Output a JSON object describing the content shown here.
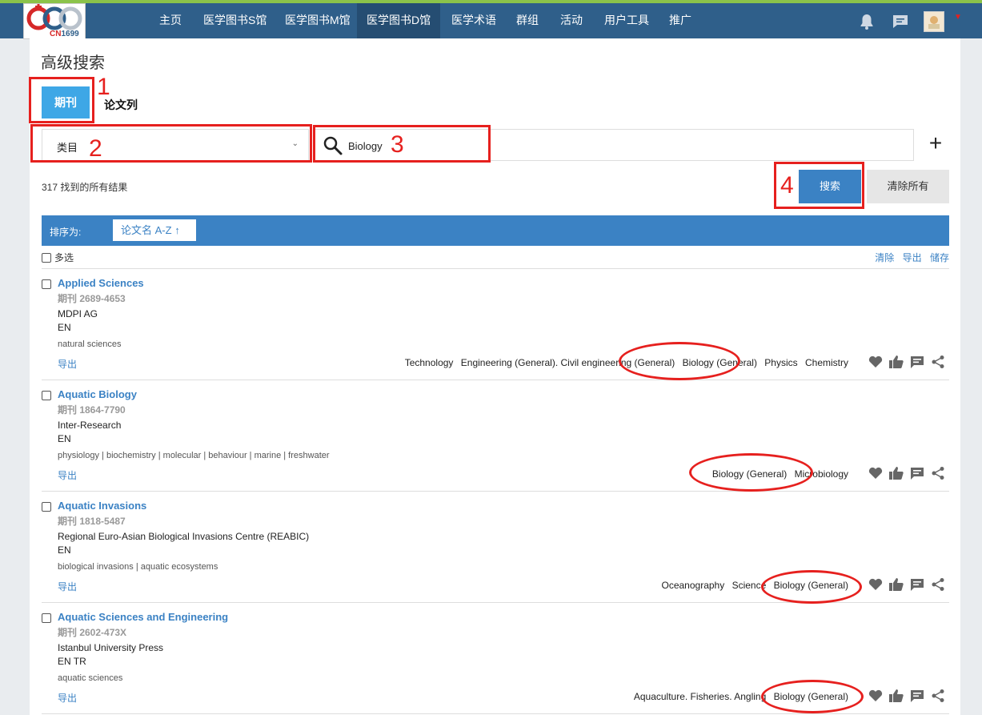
{
  "header": {
    "logo_text_a": "CN",
    "logo_text_b": "1699",
    "nav": [
      {
        "label": "主页"
      },
      {
        "label": "医学图书S馆"
      },
      {
        "label": "医学图书M馆"
      },
      {
        "label": "医学图书D馆"
      },
      {
        "label": "医学术语"
      },
      {
        "label": "群组"
      },
      {
        "label": "活动"
      },
      {
        "label": "用户工具"
      },
      {
        "label": "推广"
      }
    ],
    "active_nav": "医学图书D馆",
    "icons": [
      "bell-icon",
      "chat-icon",
      "avatar",
      "chevron-down-icon"
    ]
  },
  "page": {
    "title": "高级搜索",
    "tabs": [
      {
        "label": "期刊"
      },
      {
        "label": "论文列"
      }
    ],
    "field_select": {
      "value": "类目"
    },
    "search": {
      "value": "Biology"
    },
    "result_count": "317 找到的所有结果",
    "search_button": "搜索",
    "clear_button": "清除所有",
    "sort": {
      "label": "排序为:",
      "option": "论文名 A-Z",
      "arrow": "↑"
    },
    "select_all": "多选",
    "bulk": {
      "clear": "清除",
      "export": "导出",
      "save": "储存"
    }
  },
  "results": [
    {
      "name": "Applied Sciences",
      "issn": "期刊 2689-4653",
      "publisher": "MDPI AG",
      "lang": "EN",
      "keywords": "natural sciences",
      "export": "导出",
      "subjects": [
        "Technology",
        "Engineering (General). Civil engineering (General)",
        "Biology (General)",
        "Physics",
        "Chemistry"
      ]
    },
    {
      "name": "Aquatic Biology",
      "issn": "期刊 1864-7790",
      "publisher": "Inter-Research",
      "lang": "EN",
      "keywords": "physiology | biochemistry | molecular | behaviour | marine | freshwater",
      "export": "导出",
      "subjects": [
        "Biology (General)",
        "Microbiology"
      ]
    },
    {
      "name": "Aquatic Invasions",
      "issn": "期刊 1818-5487",
      "publisher": "Regional Euro-Asian Biological Invasions Centre (REABIC)",
      "lang": "EN",
      "keywords": "biological invasions | aquatic ecosystems",
      "export": "导出",
      "subjects": [
        "Oceanography",
        "Science",
        "Biology (General)"
      ]
    },
    {
      "name": "Aquatic Sciences and Engineering",
      "issn": "期刊 2602-473X",
      "publisher": "Istanbul University Press",
      "lang": "EN TR",
      "keywords": "aquatic sciences",
      "export": "导出",
      "subjects": [
        "Aquaculture. Fisheries. Angling",
        "Biology (General)"
      ]
    }
  ],
  "annotations": [
    "1",
    "2",
    "3",
    "4"
  ],
  "colors": {
    "nav_bg": "#2f5f8a",
    "accent": "#3b82c4",
    "tab_active": "#3ea7e6",
    "annotation": "#e6201e"
  }
}
